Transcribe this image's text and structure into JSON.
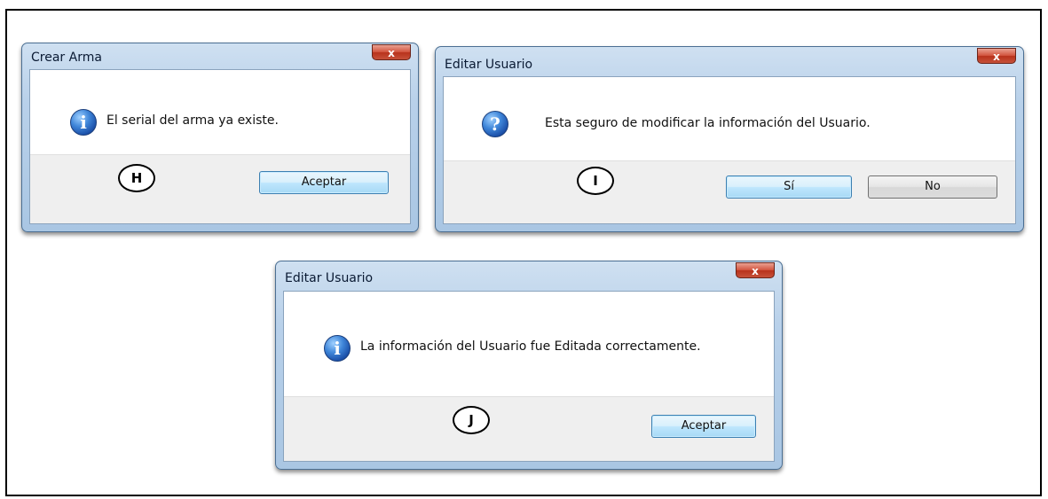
{
  "dialogs": [
    {
      "title": "Crear Arma",
      "close_label": "x",
      "icon": "info-icon",
      "icon_glyph": "i",
      "message": "El serial del arma ya existe.",
      "marker": "H",
      "buttons": [
        "Aceptar"
      ]
    },
    {
      "title": "Editar Usuario",
      "close_label": "x",
      "icon": "question-icon",
      "icon_glyph": "?",
      "message": "Esta seguro de modificar la información del Usuario.",
      "marker": "I",
      "buttons": [
        "Sí",
        "No"
      ]
    },
    {
      "title": "Editar Usuario",
      "close_label": "x",
      "icon": "info-icon",
      "icon_glyph": "i",
      "message": "La información del Usuario fue Editada correctamente.",
      "marker": "J",
      "buttons": [
        "Aceptar"
      ]
    }
  ],
  "colors": {
    "title_bar": "#b9d1ea",
    "close_button": "#c6513a",
    "default_button_border": "#3c7fb1",
    "footer": "#efefef"
  }
}
